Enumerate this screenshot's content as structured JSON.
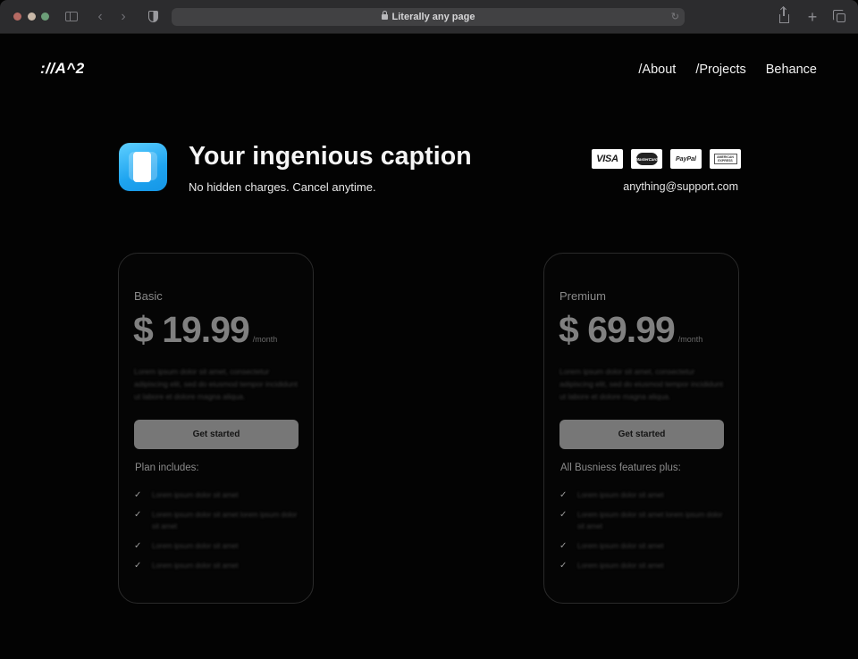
{
  "browser": {
    "url_text": "Literally any page",
    "icons": {
      "sidebar": "sidebar-icon",
      "back": "‹",
      "forward": "›",
      "reload": "↻",
      "new_tab": "+"
    }
  },
  "site": {
    "logo": "://A^2",
    "nav": [
      {
        "label": "/About"
      },
      {
        "label": "/Projects"
      },
      {
        "label": "Behance"
      }
    ]
  },
  "hero": {
    "caption": "Your ingenious caption",
    "subcaption": "No hidden charges. Cancel anytime.",
    "payments": [
      {
        "name": "visa",
        "label": "VISA"
      },
      {
        "name": "mastercard",
        "label": "MasterCard"
      },
      {
        "name": "paypal",
        "label": "PayPal"
      },
      {
        "name": "amex",
        "label": "AMERICAN EXPRESS"
      }
    ],
    "support_email": "anything@support.com",
    "accent_color": "#1ea4f0"
  },
  "plans": [
    {
      "name": "Basic",
      "price": "$ 19.99",
      "period": "/month",
      "description": "Lorem ipsum dolor sit amet, consectetur adipiscing elit, sed do eiusmod tempor incididunt ut labore et dolore magna aliqua.",
      "cta": "Get started",
      "includes_title": "Plan includes:",
      "features": [
        "Lorem ipsum dolor sit amet",
        "Lorem ipsum dolor sit amet lorem ipsum dolor sit amet",
        "Lorem ipsum dolor sit amet",
        "Lorem ipsum dolor sit amet"
      ]
    },
    {
      "name": "Premium",
      "price": "$ 69.99",
      "period": "/month",
      "description": "Lorem ipsum dolor sit amet, consectetur adipiscing elit, sed do eiusmod tempor incididunt ut labore et dolore magna aliqua.",
      "cta": "Get started",
      "includes_title": "All Busniess features plus:",
      "features": [
        "Lorem ipsum dolor sit amet",
        "Lorem ipsum dolor sit amet lorem ipsum dolor sit amet",
        "Lorem ipsum dolor sit amet",
        "Lorem ipsum dolor sit amet"
      ]
    }
  ],
  "check_glyph": "✓"
}
